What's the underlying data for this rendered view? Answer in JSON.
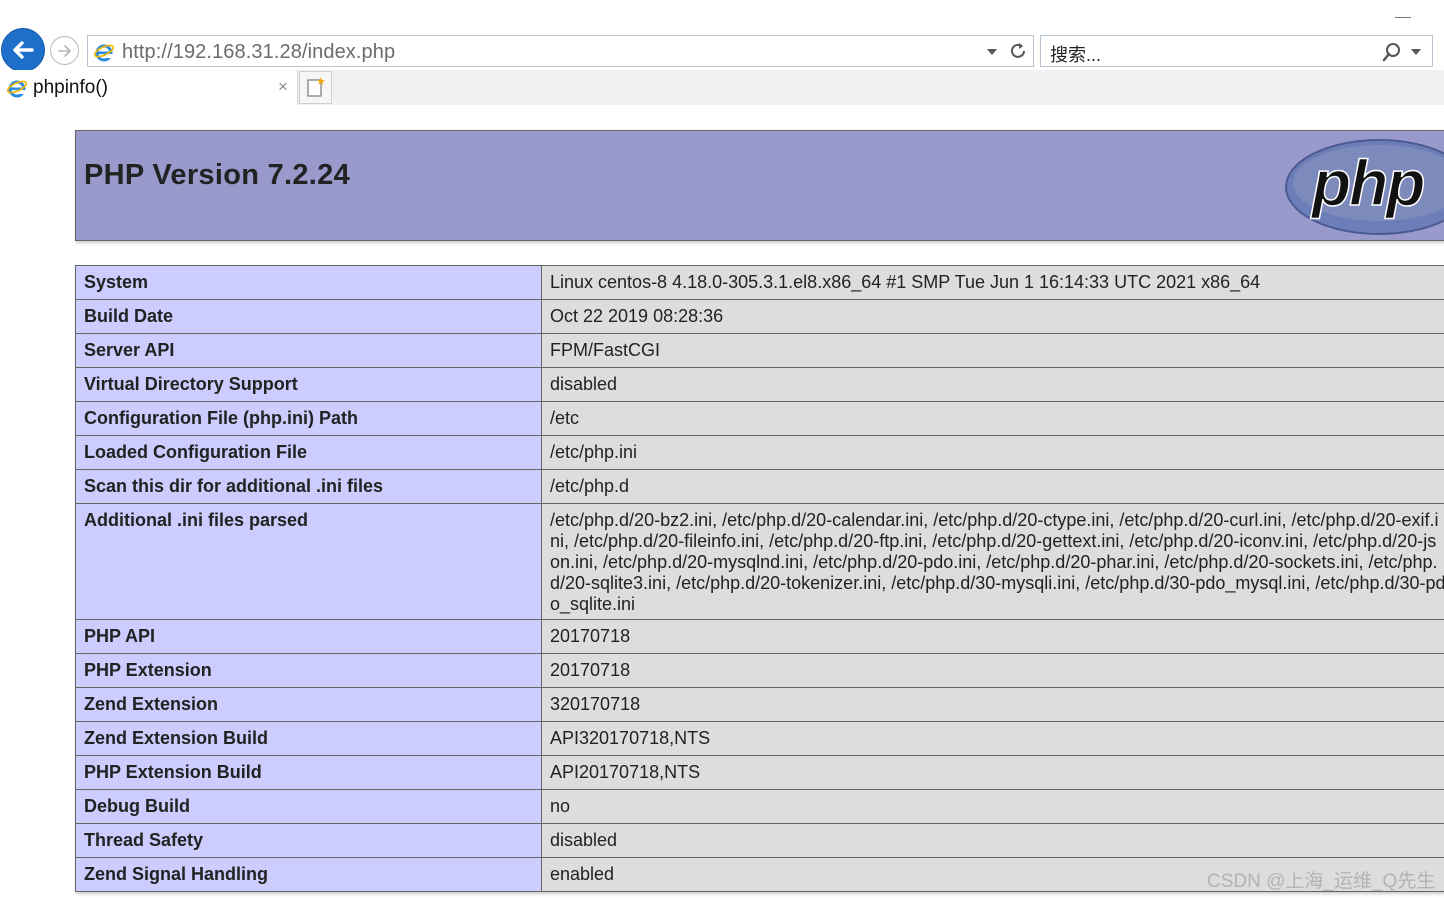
{
  "browser": {
    "address": "http://192.168.31.28/index.php",
    "search_placeholder": "搜索...",
    "tab_title": "phpinfo()",
    "tab_close": "×"
  },
  "php": {
    "title": "PHP Version 7.2.24",
    "logo_text": "php",
    "header_color": "#9999cc",
    "key_cell_color": "#ccccff",
    "value_cell_color": "#dddddd"
  },
  "rows": [
    {
      "key": "System",
      "value": "Linux centos-8 4.18.0-305.3.1.el8.x86_64 #1 SMP Tue Jun 1 16:14:33 UTC 2021 x86_64"
    },
    {
      "key": "Build Date",
      "value": "Oct 22 2019 08:28:36"
    },
    {
      "key": "Server API",
      "value": "FPM/FastCGI"
    },
    {
      "key": "Virtual Directory Support",
      "value": "disabled"
    },
    {
      "key": "Configuration File (php.ini) Path",
      "value": "/etc"
    },
    {
      "key": "Loaded Configuration File",
      "value": "/etc/php.ini"
    },
    {
      "key": "Scan this dir for additional .ini files",
      "value": "/etc/php.d"
    },
    {
      "key": "Additional .ini files parsed",
      "value": "/etc/php.d/20-bz2.ini, /etc/php.d/20-calendar.ini, /etc/php.d/20-ctype.ini, /etc/php.d/20-curl.ini, /etc/php.d/20-exif.ini, /etc/php.d/20-fileinfo.ini, /etc/php.d/20-ftp.ini, /etc/php.d/20-gettext.ini, /etc/php.d/20-iconv.ini, /etc/php.d/20-json.ini, /etc/php.d/20-mysqlnd.ini, /etc/php.d/20-pdo.ini, /etc/php.d/20-phar.ini, /etc/php.d/20-sockets.ini, /etc/php.d/20-sqlite3.ini, /etc/php.d/20-tokenizer.ini, /etc/php.d/30-mysqli.ini, /etc/php.d/30-pdo_mysql.ini, /etc/php.d/30-pdo_sqlite.ini"
    },
    {
      "key": "PHP API",
      "value": "20170718"
    },
    {
      "key": "PHP Extension",
      "value": "20170718"
    },
    {
      "key": "Zend Extension",
      "value": "320170718"
    },
    {
      "key": "Zend Extension Build",
      "value": "API320170718,NTS"
    },
    {
      "key": "PHP Extension Build",
      "value": "API20170718,NTS"
    },
    {
      "key": "Debug Build",
      "value": "no"
    },
    {
      "key": "Thread Safety",
      "value": "disabled"
    },
    {
      "key": "Zend Signal Handling",
      "value": "enabled"
    }
  ],
  "watermark": "CSDN @上海_运维_Q先生"
}
